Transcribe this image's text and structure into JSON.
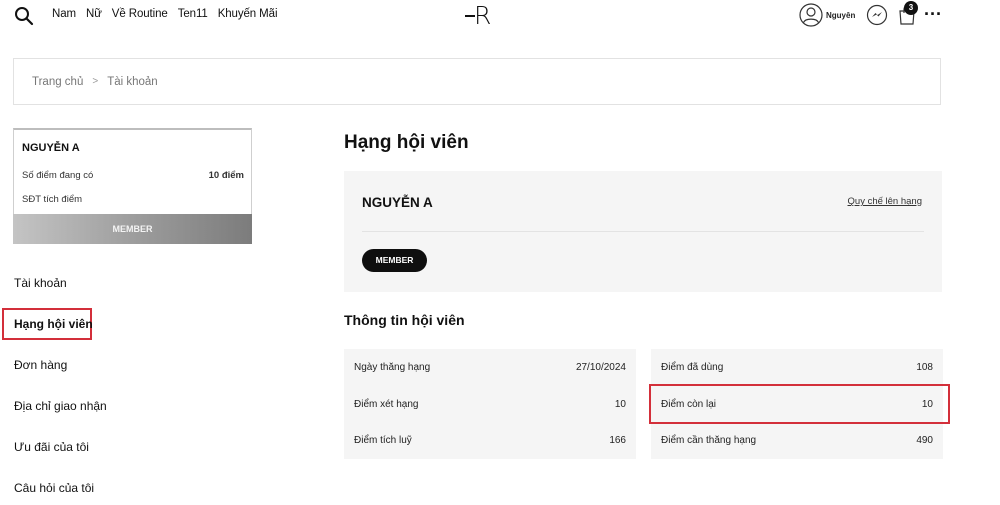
{
  "header": {
    "nav": [
      "Nam",
      "Nữ",
      "Về Routine",
      "Ten11",
      "Khuyến Mãi"
    ],
    "logo": "R",
    "user_name": "Nguyên",
    "cart_count": "3",
    "more": "···"
  },
  "breadcrumb": {
    "home": "Trang chủ",
    "separator": ">",
    "current": "Tài khoản"
  },
  "side_card": {
    "name": "NGUYỄN A",
    "points_label": "Số điểm đang có",
    "points_value": "10 điểm",
    "phone_label": "SĐT tích điểm",
    "tier": "MEMBER"
  },
  "side_menu": {
    "items": [
      "Tài khoản",
      "Hạng hội viên",
      "Đơn hàng",
      "Địa chỉ giao nhận",
      "Ưu đãi của tôi",
      "Câu hỏi của tôi"
    ],
    "active": "Hạng hội viên"
  },
  "main": {
    "title": "Hạng hội viên",
    "member_name": "NGUYỄN A",
    "rule_link": "Quy chế lên hạng",
    "tier_badge": "MEMBER",
    "section_title": "Thông tin hội viên",
    "left_rows": [
      {
        "label": "Ngày thăng hạng",
        "value": "27/10/2024"
      },
      {
        "label": "Điểm xét hạng",
        "value": "10"
      },
      {
        "label": "Điểm tích luỹ",
        "value": "166"
      }
    ],
    "right_rows": [
      {
        "label": "Điểm đã dùng",
        "value": "108"
      },
      {
        "label": "Điểm còn lại",
        "value": "10"
      },
      {
        "label": "Điểm cần thăng hạng",
        "value": "490"
      }
    ]
  },
  "colors": {
    "highlight": "#d32f3a",
    "panel_bg": "#f5f5f5",
    "pill_bg": "#0f0f0f"
  }
}
